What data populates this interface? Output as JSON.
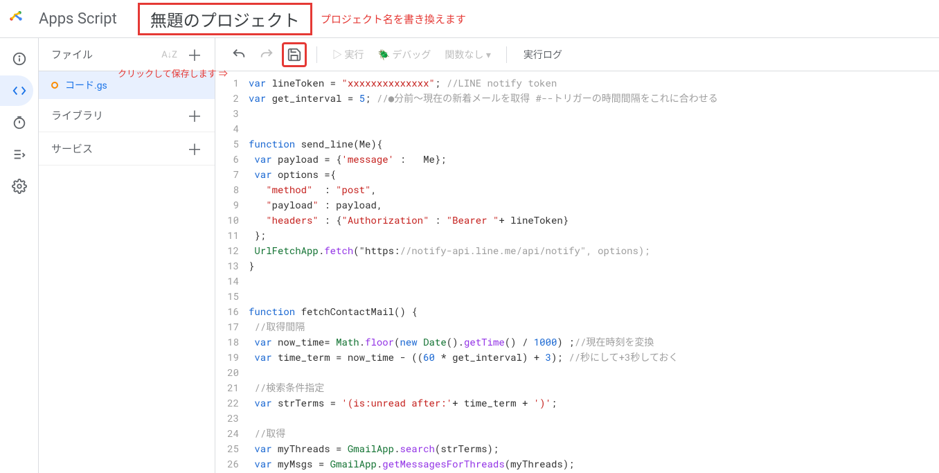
{
  "header": {
    "app_name": "Apps Script",
    "project_title": "無題のプロジェクト",
    "annotation": "プロジェクト名を書き換えます"
  },
  "rail": {
    "items": [
      "info",
      "code",
      "clock",
      "list",
      "settings"
    ],
    "active_index": 1
  },
  "sidebar": {
    "files_header": "ファイル",
    "file_name": "コード.gs",
    "library_label": "ライブラリ",
    "services_label": "サービス",
    "save_annotation": "クリックして保存します ⇒"
  },
  "toolbar": {
    "run_label": "実行",
    "debug_label": "デバッグ",
    "func_label": "関数なし",
    "log_label": "実行ログ"
  },
  "code": {
    "lines": [
      {
        "n": 1,
        "raw": "var lineToken = \"xxxxxxxxxxxxxx\"; //LINE notify token"
      },
      {
        "n": 2,
        "raw": "var get_interval = 5; //●分前～現在の新着メールを取得 #--トリガーの時間間隔をこれに合わせる"
      },
      {
        "n": 3,
        "raw": ""
      },
      {
        "n": 4,
        "raw": ""
      },
      {
        "n": 5,
        "raw": "function send_line(Me){"
      },
      {
        "n": 6,
        "raw": " var payload = {'message' :   Me};"
      },
      {
        "n": 7,
        "raw": " var options ={"
      },
      {
        "n": 8,
        "raw": "   \"method\"  : \"post\","
      },
      {
        "n": 9,
        "raw": "   \"payload\" : payload,"
      },
      {
        "n": 10,
        "raw": "   \"headers\" : {\"Authorization\" : \"Bearer \"+ lineToken}"
      },
      {
        "n": 11,
        "raw": " };"
      },
      {
        "n": 12,
        "raw": " UrlFetchApp.fetch(\"https://notify-api.line.me/api/notify\", options);"
      },
      {
        "n": 13,
        "raw": "}"
      },
      {
        "n": 14,
        "raw": ""
      },
      {
        "n": 15,
        "raw": ""
      },
      {
        "n": 16,
        "raw": "function fetchContactMail() {"
      },
      {
        "n": 17,
        "raw": " //取得間隔"
      },
      {
        "n": 18,
        "raw": " var now_time= Math.floor(new Date().getTime() / 1000) ;//現在時刻を変換"
      },
      {
        "n": 19,
        "raw": " var time_term = now_time - ((60 * get_interval) + 3); //秒にして+3秒しておく"
      },
      {
        "n": 20,
        "raw": ""
      },
      {
        "n": 21,
        "raw": " //検索条件指定"
      },
      {
        "n": 22,
        "raw": " var strTerms = '(is:unread after:'+ time_term + ')';"
      },
      {
        "n": 23,
        "raw": ""
      },
      {
        "n": 24,
        "raw": " //取得"
      },
      {
        "n": 25,
        "raw": " var myThreads = GmailApp.search(strTerms);"
      },
      {
        "n": 26,
        "raw": " var myMsgs = GmailApp.getMessagesForThreads(myThreads);"
      }
    ]
  }
}
